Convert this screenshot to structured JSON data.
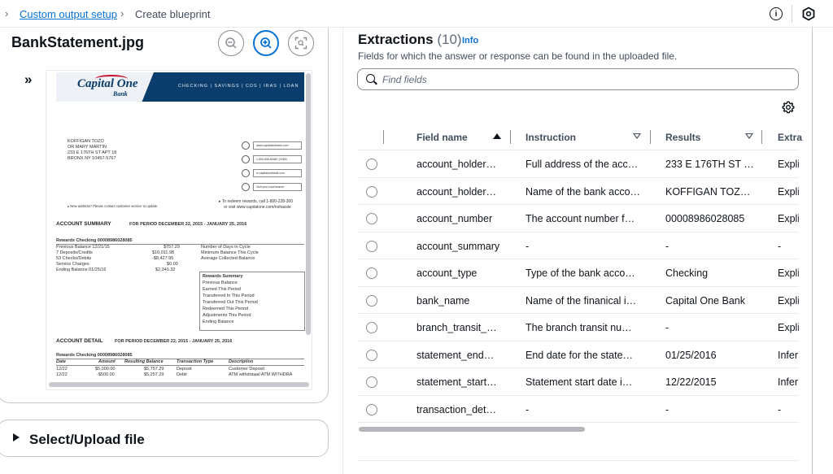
{
  "breadcrumb": {
    "parent": "Custom output setup",
    "current": "Create blueprint"
  },
  "topbar": {
    "info_icon": "info-icon",
    "settings_icon": "hexagon-icon"
  },
  "document": {
    "file_name": "BankStatement.jpg",
    "zoom_controls": [
      "zoom-out-icon",
      "zoom-in-icon",
      "fit-to-screen-icon"
    ],
    "preview": {
      "logo": "Capital One",
      "logo_sub": "Bank",
      "nav": "CHECKING | SAVINGS | CDS | IRAS | LOAN",
      "address": [
        "KOFFIGAN TOZO",
        "OR MARY MARTIN",
        "233 E 176TH ST APT 18",
        "BRONX NY  10457-5767"
      ],
      "contacts": [
        "www.capitalonebank.com",
        "1-800-655-BANK (2265)",
        "m.capitalonebank.com",
        "Visit your local branch"
      ],
      "new_address_note": "▸ New address? Please contact customer service to update.",
      "rewards_note_1": "▸ To redeem rewards, call 1-800-228-300",
      "rewards_note_2": "or visit www.capitalone.com/nohassle",
      "summary_title": "ACCOUNT SUMMARY",
      "summary_period": "FOR PERIOD  DECEMBER 22, 2015  -  JANUARY 25, 2016",
      "rewards_checking": "Rewards Checking  00008986028085",
      "summary_rows": [
        {
          "label": "Previous Balance  12/21/15",
          "value": "$757.29"
        },
        {
          "label": "7 Deposits/Credits",
          "value": "$10,011.98"
        },
        {
          "label": "53 Checks/Debits",
          "value": "-$8,427.95"
        },
        {
          "label": "Service Charges",
          "value": "$0.00"
        },
        {
          "label": "Ending Balance 01/25/16",
          "value": "$2,341.32"
        }
      ],
      "summary_right": [
        "Number of Days in Cycle",
        "Minimum Balance This Cycle",
        "Average Collected Balance"
      ],
      "rewards_summary": [
        "Rewards Summary",
        "Previous Balance",
        "  Earned This Period",
        "  Transferred In This Period",
        "  Transferred Out This Period",
        "  Redeemed This Period",
        "  Adjustments This Period",
        "Ending Balance"
      ],
      "detail_title": "ACCOUNT DETAIL",
      "detail_period": "FOR PERIOD  DECEMBER 22, 2015  -  JANUARY 25, 2016",
      "detail_checking": "Rewards Checking 00008986028085",
      "detail_headers": [
        "Date",
        "Amount",
        "Resulting Balance",
        "Transaction Type",
        "Description"
      ],
      "detail_rows": [
        [
          "12/22",
          "$5,000.00",
          "$5,757.29",
          "Deposit",
          "Customer Deposit"
        ],
        [
          "12/22",
          "-$500.00",
          "$5,257.29",
          "Debit",
          "ATM withdrawal ATM WITHDRA"
        ]
      ]
    },
    "select_upload_label": "Select/Upload file"
  },
  "extractions": {
    "title": "Extractions",
    "count": "(10)",
    "info_link": "Info",
    "description": "Fields for which the answer or response can be found in the uploaded file.",
    "search_placeholder": "Find fields",
    "columns": [
      "Field name",
      "Instruction",
      "Results",
      "Extra"
    ],
    "rows": [
      {
        "field": "account_holder…",
        "instruction": "Full address of the acc…",
        "result": "233 E 176TH ST …",
        "extraction": "Expli"
      },
      {
        "field": "account_holder…",
        "instruction": "Name of the bank acco…",
        "result": "KOFFIGAN TOZ…",
        "extraction": "Expli"
      },
      {
        "field": "account_number",
        "instruction": "The account number f…",
        "result": "00008986028085",
        "extraction": "Expli"
      },
      {
        "field": "account_summary",
        "instruction": "-",
        "result": "-",
        "extraction": "-"
      },
      {
        "field": "account_type",
        "instruction": "Type of the bank acco…",
        "result": "Checking",
        "extraction": "Expli"
      },
      {
        "field": "bank_name",
        "instruction": "Name of the finanical i…",
        "result": "Capital One Bank",
        "extraction": "Expli"
      },
      {
        "field": "branch_transit_…",
        "instruction": "The branch transit nu…",
        "result": "-",
        "extraction": "Expli"
      },
      {
        "field": "statement_end…",
        "instruction": "End date for the state…",
        "result": "01/25/2016",
        "extraction": "Infer"
      },
      {
        "field": "statement_start…",
        "instruction": "Statement start date i…",
        "result": "12/22/2015",
        "extraction": "Infer"
      },
      {
        "field": "transaction_det…",
        "instruction": "-",
        "result": "-",
        "extraction": "-"
      }
    ]
  },
  "colors": {
    "link": "#0972d3",
    "text": "#0f141a",
    "border": "#c6c6cd",
    "bank_header": "#0a3d6b"
  }
}
